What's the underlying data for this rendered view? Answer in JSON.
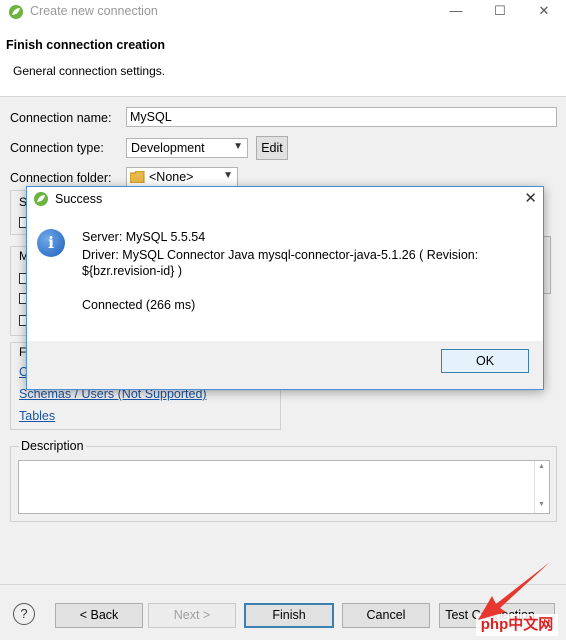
{
  "window": {
    "title": "Create new connection",
    "minimize": "—",
    "maximize": "☐",
    "close": "✕"
  },
  "header": {
    "title": "Finish connection creation",
    "subtitle": "General connection settings."
  },
  "form": {
    "connection_name_label": "Connection name:",
    "connection_name_value": "MySQL",
    "connection_type_label": "Connection type:",
    "connection_type_value": "Development",
    "edit_label": "Edit",
    "connection_folder_label": "Connection folder:",
    "connection_folder_value": "<None>"
  },
  "partial": {
    "s": "S",
    "m": "M",
    "f": "F",
    "c": "C"
  },
  "links": {
    "schemas": "Schemas / Users (Not Supported)",
    "tables": "Tables"
  },
  "description": {
    "label": "Description",
    "value": ""
  },
  "dialog": {
    "title": "Success",
    "server": "Server: MySQL 5.5.54",
    "driver_line1": "Driver: MySQL Connector Java mysql-connector-java-5.1.26 ( Revision:",
    "driver_line2": "${bzr.revision-id} )",
    "connected": "Connected (266 ms)",
    "ok": "OK"
  },
  "footer": {
    "help": "?",
    "back": "< Back",
    "next": "Next >",
    "finish": "Finish",
    "cancel": "Cancel",
    "test": "Test Connection ...",
    "watermark": "php中文网"
  },
  "colors": {
    "accent": "#3c7fb1",
    "link": "#1a55a5",
    "arrow": "#e8372f"
  },
  "icons": [
    "spring-leaf-icon",
    "folder-icon",
    "info-icon",
    "help-icon",
    "close-icon",
    "minimize-icon",
    "maximize-icon"
  ]
}
